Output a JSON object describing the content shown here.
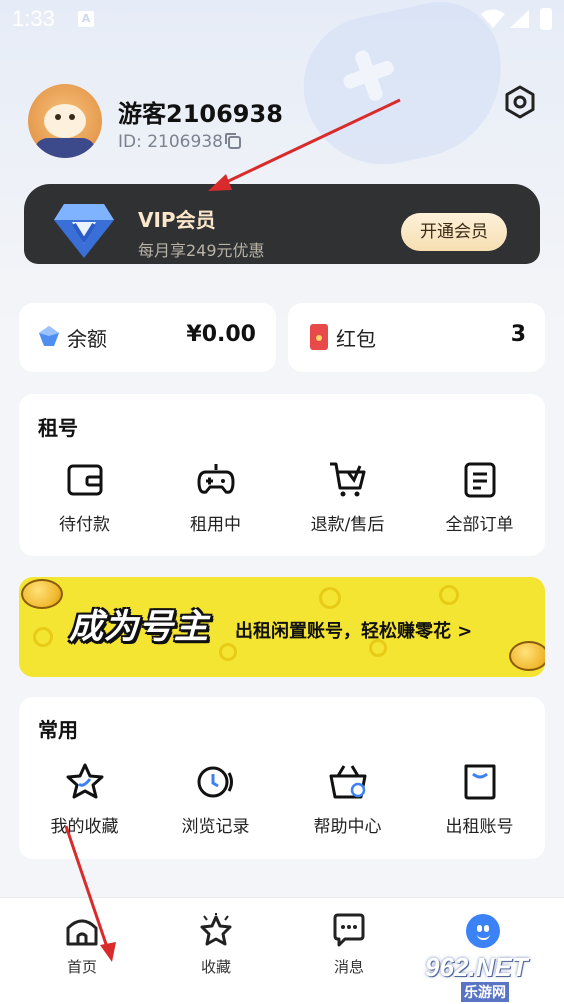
{
  "status_bar": {
    "time": "1:33",
    "indicator": "A"
  },
  "profile": {
    "username": "游客2106938",
    "user_id": "ID: 2106938"
  },
  "vip": {
    "title": "VIP会员",
    "subtitle": "每月享249元优惠",
    "button": "开通会员"
  },
  "wallet": {
    "balance_label": "余额",
    "balance_value": "¥0.00",
    "redpacket_label": "红包",
    "redpacket_value": "3"
  },
  "rent": {
    "title": "租号",
    "items": [
      {
        "label": "待付款",
        "icon": "wallet-icon"
      },
      {
        "label": "租用中",
        "icon": "gamepad-icon"
      },
      {
        "label": "退款/售后",
        "icon": "cart-icon"
      },
      {
        "label": "全部订单",
        "icon": "order-list-icon"
      }
    ]
  },
  "banner": {
    "title": "成为号主",
    "text": "出租闲置账号，轻松赚零花 >"
  },
  "common": {
    "title": "常用",
    "items": [
      {
        "label": "我的收藏",
        "icon": "star-icon"
      },
      {
        "label": "浏览记录",
        "icon": "clock-icon"
      },
      {
        "label": "帮助中心",
        "icon": "help-basket-icon"
      },
      {
        "label": "出租账号",
        "icon": "bag-icon"
      }
    ]
  },
  "tab_bar": {
    "items": [
      {
        "label": "首页",
        "icon": "home-icon"
      },
      {
        "label": "收藏",
        "icon": "star-tab-icon"
      },
      {
        "label": "消息",
        "icon": "message-icon"
      },
      {
        "label": "",
        "icon": "me-icon"
      }
    ]
  },
  "watermark": {
    "main": "962.NET",
    "sub": "乐游网"
  },
  "colors": {
    "vip_card": "#2f3133",
    "vip_gold": "#fbe7c9",
    "banner_yellow": "#f4e533",
    "active_tab": "#3b82f6",
    "annotation_arrow": "#d92b2b"
  }
}
